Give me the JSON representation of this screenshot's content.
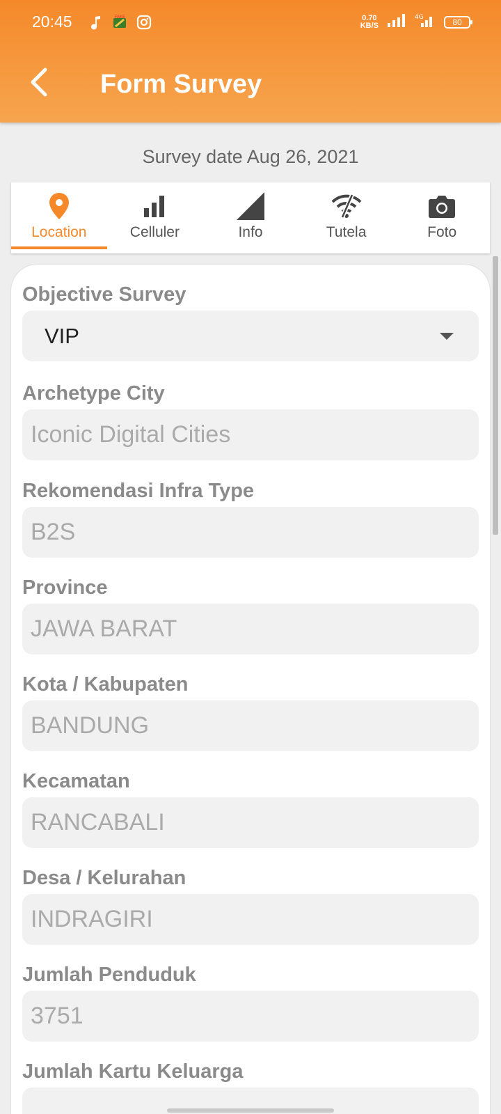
{
  "status_bar": {
    "time": "20:45",
    "net_speed_value": "0.70",
    "net_speed_unit": "KB/S",
    "network_type": "4G",
    "battery": "80",
    "icons": [
      "music-note-icon",
      "fake-gps-icon",
      "instagram-icon",
      "wifi-signal-icon",
      "cell-signal-icon",
      "battery-icon"
    ]
  },
  "app_bar": {
    "title": "Form Survey",
    "back_icon": "back-arrow-icon"
  },
  "survey_date": "Survey date Aug 26, 2021",
  "tabs": [
    {
      "label": "Location",
      "icon": "location-pin-icon",
      "active": true
    },
    {
      "label": "Celluler",
      "icon": "signal-bars-icon",
      "active": false
    },
    {
      "label": "Info",
      "icon": "signal-triangle-icon",
      "active": false
    },
    {
      "label": "Tutela",
      "icon": "wifi-off-icon",
      "active": false
    },
    {
      "label": "Foto",
      "icon": "camera-icon",
      "active": false
    }
  ],
  "form": {
    "objective_survey": {
      "label": "Objective Survey",
      "value": "VIP"
    },
    "archetype_city": {
      "label": "Archetype City",
      "value": "Iconic Digital Cities"
    },
    "infra_type": {
      "label": "Rekomendasi Infra Type",
      "value": "B2S"
    },
    "province": {
      "label": "Province",
      "value": "JAWA BARAT"
    },
    "kota": {
      "label": "Kota / Kabupaten",
      "value": "BANDUNG"
    },
    "kecamatan": {
      "label": "Kecamatan",
      "value": "RANCABALI"
    },
    "desa": {
      "label": "Desa / Kelurahan",
      "value": "INDRAGIRI"
    },
    "penduduk": {
      "label": "Jumlah Penduduk",
      "value": "3751"
    },
    "kartu_keluarga": {
      "label": "Jumlah Kartu Keluarga",
      "value": ""
    }
  },
  "colors": {
    "accent": "#F5892A",
    "label_gray": "#8A8A8A",
    "field_bg": "#F1F1F1"
  }
}
